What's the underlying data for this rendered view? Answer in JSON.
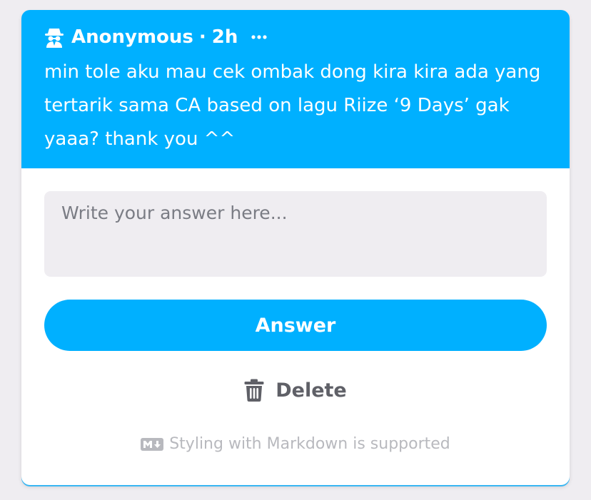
{
  "question": {
    "author": "Anonymous",
    "separator": "·",
    "time_ago": "2h",
    "author_icon": "anonymous-spy-icon",
    "more_icon": "more-options-icon",
    "text": "min tole aku mau cek ombak dong kira kira ada yang tertarik sama CA based on lagu Riize ‘9 Days’ gak yaaa? thank you ^^"
  },
  "answer_form": {
    "placeholder": "Write your answer here...",
    "value": "",
    "answer_button_label": "Answer",
    "delete_button_label": "Delete",
    "delete_icon": "trash-icon",
    "markdown_icon": "markdown-icon",
    "markdown_note": "Styling with Markdown is supported"
  },
  "colors": {
    "accent": "#00b0ff",
    "page_background": "#efedf1",
    "card_background": "#ffffff",
    "input_background": "#efedf1",
    "delete_text": "#5f6067",
    "muted_text": "#b8b9be"
  }
}
